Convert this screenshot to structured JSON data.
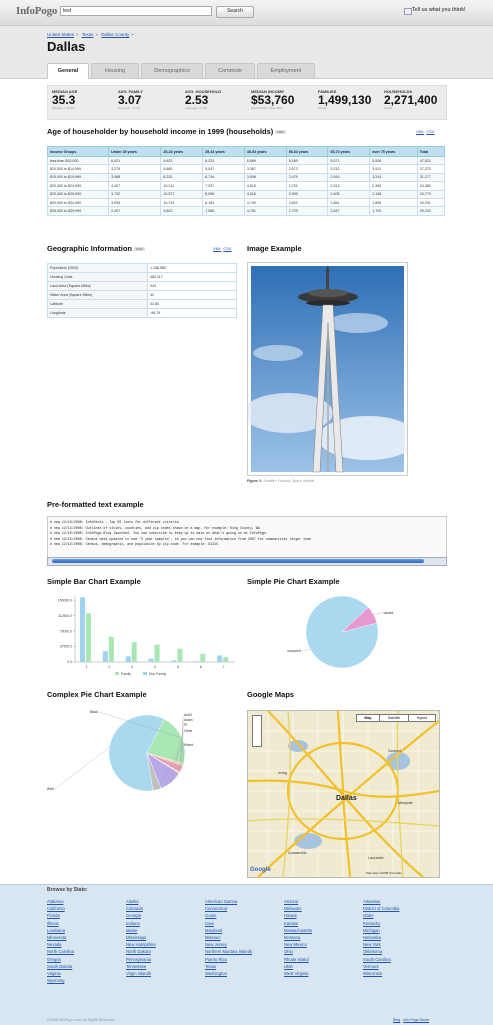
{
  "app": {
    "logo": "InfoPogo",
    "search_value": "test",
    "search_button": "Search",
    "feedback": "Tell us what you think!"
  },
  "breadcrumb": [
    "United States",
    "Texas",
    "Dallas County"
  ],
  "place": "Dallas",
  "tabs": [
    "General",
    "Housing",
    "Demographics",
    "Commute",
    "Employment"
  ],
  "stats": [
    {
      "label": "MEDIAN AGE",
      "value": "35.3",
      "sub": "(Median = 37/46)"
    },
    {
      "label": "AVG. FAMILY",
      "value": "3.07",
      "sub": "(Average = 3.14)"
    },
    {
      "label": "AVG. HOUSEHOLD",
      "value": "2.53",
      "sub": "(Average = 2.59)"
    },
    {
      "label": "MEDIAN INCOME",
      "value": "$53,760",
      "sub": "(Nat Median = $44,389)"
    },
    {
      "label": "FAMILIES",
      "value": "1,499,130",
      "sub": "(Total)"
    },
    {
      "label": "HOUSEHOLDS",
      "value": "2,271,400",
      "sub": "(Total)"
    }
  ],
  "income_table": {
    "title": "Age of householder by household income in 1999 (households)",
    "badge": "2007",
    "export": [
      "XML",
      "CSV"
    ],
    "headers": [
      "Income Groups",
      "Under 25 years",
      "25-34 years",
      "35-44 years",
      "45-54 years",
      "55-64 years",
      "65-74 years",
      "over 75 years",
      "Total"
    ],
    "rows": [
      [
        "less than $10,000",
        "6,921",
        "9,623",
        "8,223",
        "6,669",
        "5,189",
        "5,071",
        "5,526",
        "47,522"
      ],
      [
        "$10,000 to $14,999",
        "3,275",
        "5,665",
        "5,047",
        "3,367",
        "2,573",
        "3,212",
        "3,911",
        "27,270"
      ],
      [
        "$15,000 to $19,999",
        "3,988",
        "8,333",
        "6,716",
        "3,598",
        "2,479",
        "2,919",
        "3,244",
        "31,277"
      ],
      [
        "$20,000 to $24,999",
        "4,407",
        "10,211",
        "7,297",
        "4,815",
        "2,751",
        "2,513",
        "2,395",
        "34,389"
      ],
      [
        "$25,000 to $29,999",
        "3,732",
        "10,577",
        "8,096",
        "4,916",
        "2,995",
        "2,405",
        "2,158",
        "34,779"
      ],
      [
        "$30,000 to $34,999",
        "3,035",
        "10,724",
        "8,183",
        "4,740",
        "2,822",
        "1,851",
        "1,896",
        "33,241"
      ],
      [
        "$35,000 to $39,999",
        "2,497",
        "9,803",
        "7,085",
        "4,751",
        "2,729",
        "1,647",
        "1,720",
        "29,232"
      ]
    ]
  },
  "geo": {
    "title": "Geographic Information",
    "badge": "2000",
    "export": [
      "XML",
      "CSV"
    ],
    "rows": [
      [
        "Population (2000)",
        "1,188,580"
      ],
      [
        "Housing Units",
        "484,117"
      ],
      [
        "Land Area (Square Miles)",
        "343"
      ],
      [
        "Water Area (Square Miles)",
        "42"
      ],
      [
        "Latitude",
        "32.80"
      ],
      [
        "Longitude",
        "-96.79"
      ]
    ]
  },
  "image_example": {
    "title": "Image Example",
    "caption_label": "Figure 1:",
    "caption": "Seattle's Famous Space Needle"
  },
  "preformatted": {
    "title": "Pre-formatted text example",
    "lines": [
      "# new 12/16/2008: InfoHints - Top 50 lists for different criteria",
      "# new 12/13/2008: Outlines of cities, counties, and zip codes shown on a map. For example: King County, WA",
      "# new 12/10/2008: InfoPogo Blog launched. You can subscribe to keep up to date on what's going on at InfoPogo.",
      "# new 12/15/2008: Census data updated to new '3 year samples', so you can now find information from 2007 for communities larger than",
      "# new 12/12/2008: Census, demographic, and population by zip code. For example: 91215"
    ]
  },
  "chart_data": [
    {
      "type": "bar",
      "title": "Simple Bar Chart Example",
      "categories": [
        "1",
        "2",
        "3",
        "4",
        "5",
        "6",
        "7"
      ],
      "series": [
        {
          "name": "Family",
          "values": [
            118000,
            61000,
            48000,
            42000,
            32000,
            20000,
            12000
          ]
        },
        {
          "name": "Non Family",
          "values": [
            157000,
            26000,
            14000,
            8000,
            4000,
            2000,
            16000
          ]
        }
      ],
      "yticks": [
        "150000.0",
        "112500.0",
        "75000.0",
        "37500.0",
        "0.0"
      ],
      "ylim": [
        0,
        160000
      ],
      "colors": {
        "Family": "#a8e6b4",
        "Non Family": "#9fd3ee"
      }
    },
    {
      "type": "pie",
      "title": "Simple Pie Chart Example",
      "labels": [
        "occupied",
        "vacant"
      ],
      "values": [
        92,
        8
      ],
      "colors": [
        "#a9d8ef",
        "#e79ad0"
      ]
    },
    {
      "type": "pie",
      "title": "Complex Pie Chart Example",
      "labels": [
        "White",
        "Black",
        "AIAN",
        "Asian",
        "PI",
        "Other",
        "Mixed"
      ],
      "values": [
        60,
        22,
        1,
        3,
        0.5,
        10,
        3.5
      ],
      "colors": [
        "#a9d8ef",
        "#a8e6b4",
        "#f2d09a",
        "#e8a0b8",
        "#f3ee9a",
        "#b8a8e8",
        "#c0c0c0"
      ]
    }
  ],
  "maps": {
    "title": "Google Maps",
    "buttons": [
      "Map",
      "Satellite",
      "Hybrid"
    ],
    "labels": [
      "Dallas",
      "Irving",
      "Garland",
      "Mesquite",
      "Duncanville",
      "Lancaster"
    ],
    "attribution": "Map data ©2008 Tele Atlas"
  },
  "footer": {
    "browse_title": "Browse by State:",
    "columns": [
      [
        "Alabama",
        "California",
        "Florida",
        "Illinois",
        "Louisiana",
        "Minnesota",
        "Nevada",
        "North Carolina",
        "Oregon",
        "South Dakota",
        "Virginia",
        "Wyoming"
      ],
      [
        "Alaska",
        "Colorado",
        "Georgia",
        "Indiana",
        "Maine",
        "Mississippi",
        "New Hampshire",
        "North Dakota",
        "Pennsylvania",
        "Tennessee",
        "Virgin Islands"
      ],
      [
        "American Samoa",
        "Connecticut",
        "Guam",
        "Iowa",
        "Maryland",
        "Missouri",
        "New Jersey",
        "Northern Mariana Islands",
        "Puerto Rico",
        "Texas",
        "Washington"
      ],
      [
        "Arizona",
        "Delaware",
        "Hawaii",
        "Kansas",
        "Massachusetts",
        "Montana",
        "New Mexico",
        "Ohio",
        "Rhode Island",
        "Utah",
        "West Virginia"
      ],
      [
        "Arkansas",
        "District of Columbia",
        "Idaho",
        "Kentucky",
        "Michigan",
        "Nebraska",
        "New York",
        "Oklahoma",
        "South Carolina",
        "Vermont",
        "Wisconsin"
      ]
    ],
    "copyright": "©2008 InfoPogo.com. All Rights Reserved.",
    "links": [
      "Blog",
      "Info Pogo Home"
    ]
  }
}
